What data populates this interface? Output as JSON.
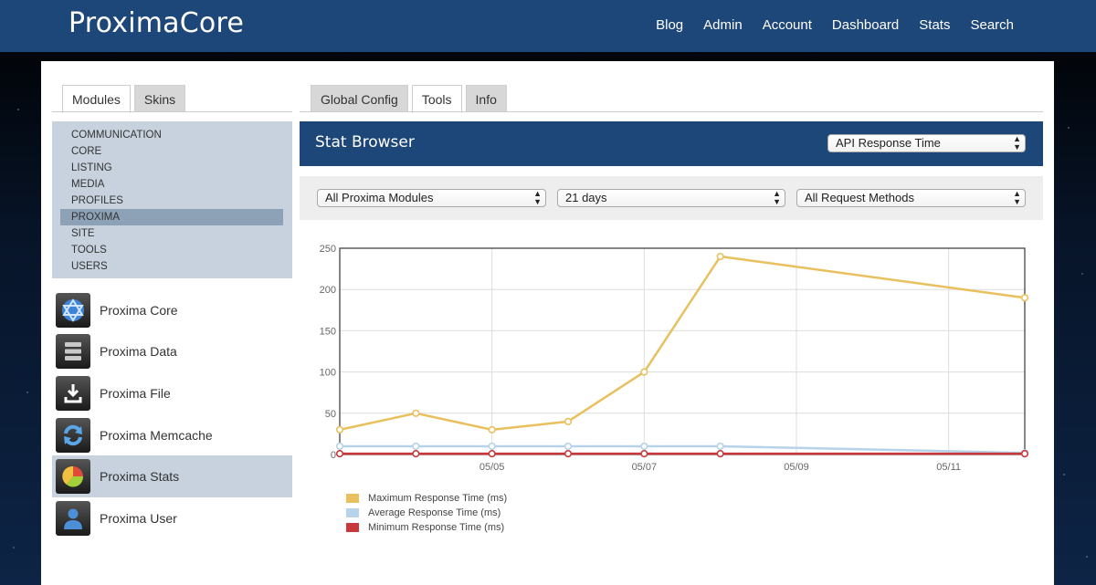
{
  "app": {
    "brand": "ProximaCore",
    "nav": [
      "Blog",
      "Admin",
      "Account",
      "Dashboard",
      "Stats",
      "Search"
    ]
  },
  "left_tabs": [
    {
      "label": "Modules",
      "active": true
    },
    {
      "label": "Skins",
      "active": false
    }
  ],
  "right_tabs": [
    {
      "label": "Global Config",
      "active": false
    },
    {
      "label": "Tools",
      "active": true
    },
    {
      "label": "Info",
      "active": false
    }
  ],
  "categories": [
    "COMMUNICATION",
    "CORE",
    "LISTING",
    "MEDIA",
    "PROFILES",
    "PROXIMA",
    "SITE",
    "TOOLS",
    "USERS"
  ],
  "selected_category": "PROXIMA",
  "modules": [
    {
      "label": "Proxima Core",
      "icon": "proxima-core-icon",
      "selected": false
    },
    {
      "label": "Proxima Data",
      "icon": "proxima-data-icon",
      "selected": false
    },
    {
      "label": "Proxima File",
      "icon": "proxima-file-icon",
      "selected": false
    },
    {
      "label": "Proxima Memcache",
      "icon": "proxima-memcache-icon",
      "selected": false
    },
    {
      "label": "Proxima Stats",
      "icon": "proxima-stats-icon",
      "selected": true
    },
    {
      "label": "Proxima User",
      "icon": "proxima-user-icon",
      "selected": false
    }
  ],
  "stat_browser": {
    "title": "Stat Browser",
    "metric": "API Response Time",
    "filters": {
      "module": "All Proxima Modules",
      "range": "21 days",
      "method": "All Request Methods"
    }
  },
  "colors": {
    "header": "#1d4778",
    "max": "#e8c05e",
    "avg": "#b7d3ea",
    "min": "#c9393b"
  },
  "chart_data": {
    "type": "line",
    "x": [
      "05/03",
      "05/04",
      "05/05",
      "05/06",
      "05/07",
      "05/08",
      "05/12"
    ],
    "xticks": [
      "05/05",
      "05/07",
      "05/09",
      "05/11"
    ],
    "xlim": [
      "05/03",
      "05/12"
    ],
    "ylim": [
      0,
      250
    ],
    "yticks": [
      0,
      50,
      100,
      150,
      200,
      250
    ],
    "grid": true,
    "legend_position": "bottom-left",
    "series": [
      {
        "name": "Maximum Response Time (ms)",
        "values": [
          30,
          50,
          30,
          40,
          100,
          240,
          190
        ]
      },
      {
        "name": "Average Response Time (ms)",
        "values": [
          10,
          10,
          10,
          10,
          10,
          10,
          2
        ]
      },
      {
        "name": "Minimum Response Time (ms)",
        "values": [
          1,
          1,
          1,
          1,
          1,
          1,
          1
        ]
      }
    ]
  }
}
